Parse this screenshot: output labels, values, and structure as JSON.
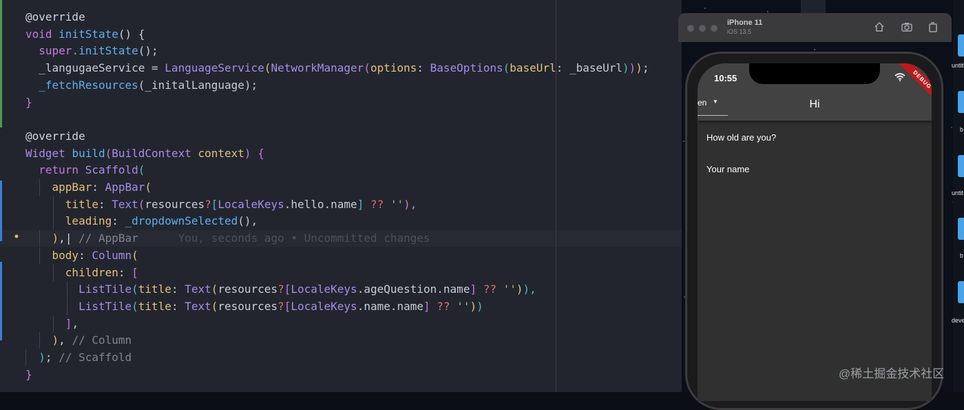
{
  "editor": {
    "lines": [
      {
        "tokens": [
          {
            "t": "@override",
            "c": "ann"
          }
        ]
      },
      {
        "tokens": [
          {
            "t": "void ",
            "c": "kw"
          },
          {
            "t": "initState",
            "c": "fn"
          },
          {
            "t": "() {",
            "c": "default"
          }
        ]
      },
      {
        "tokens": [
          {
            "t": "  "
          },
          {
            "t": "super",
            "c": "kw"
          },
          {
            "t": ".initState",
            "c": "fn"
          },
          {
            "t": "();",
            "c": "default"
          }
        ]
      },
      {
        "tokens": [
          {
            "t": "  _langugaeService = ",
            "c": "default"
          },
          {
            "t": "LanguageService",
            "c": "cls"
          },
          {
            "t": "(",
            "c": "p1"
          },
          {
            "t": "NetworkManager",
            "c": "cls"
          },
          {
            "t": "(",
            "c": "p2"
          },
          {
            "t": "options",
            "c": "prop"
          },
          {
            "t": ": ",
            "c": "default"
          },
          {
            "t": "BaseOptions",
            "c": "cls"
          },
          {
            "t": "(",
            "c": "p3"
          },
          {
            "t": "baseUrl",
            "c": "prop"
          },
          {
            "t": ": _baseUrl",
            "c": "default"
          },
          {
            "t": ")",
            "c": "p3"
          },
          {
            "t": ")",
            "c": "p2"
          },
          {
            "t": ")",
            "c": "p1"
          },
          {
            "t": ";",
            "c": "default"
          }
        ]
      },
      {
        "tokens": [
          {
            "t": "  _fetchResources",
            "c": "fn"
          },
          {
            "t": "(_initalLanguage);",
            "c": "default"
          }
        ]
      },
      {
        "tokens": [
          {
            "t": "}",
            "c": "p2"
          }
        ]
      },
      {
        "tokens": []
      },
      {
        "tokens": [
          {
            "t": "@override",
            "c": "ann"
          }
        ]
      },
      {
        "tokens": [
          {
            "t": "Widget ",
            "c": "cls"
          },
          {
            "t": "build",
            "c": "fn"
          },
          {
            "t": "(",
            "c": "p2"
          },
          {
            "t": "BuildContext ",
            "c": "cls"
          },
          {
            "t": "context",
            "c": "prop"
          },
          {
            "t": ") {",
            "c": "p2"
          }
        ]
      },
      {
        "tokens": [
          {
            "t": "  "
          },
          {
            "t": "return ",
            "c": "kw"
          },
          {
            "t": "Scaffold",
            "c": "cls"
          },
          {
            "t": "(",
            "c": "p3"
          }
        ]
      },
      {
        "tokens": [
          {
            "t": "    "
          },
          {
            "t": "appBar",
            "c": "prop"
          },
          {
            "t": ": ",
            "c": "default"
          },
          {
            "t": "AppBar",
            "c": "cls"
          },
          {
            "t": "(",
            "c": "p1"
          }
        ]
      },
      {
        "tokens": [
          {
            "t": "      "
          },
          {
            "t": "title",
            "c": "prop"
          },
          {
            "t": ": ",
            "c": "default"
          },
          {
            "t": "Text",
            "c": "cls"
          },
          {
            "t": "(",
            "c": "p2"
          },
          {
            "t": "resources",
            "c": "default"
          },
          {
            "t": "?",
            "c": "op"
          },
          {
            "t": "[",
            "c": "p3"
          },
          {
            "t": "LocaleKeys",
            "c": "cls"
          },
          {
            "t": ".hello.name",
            "c": "default"
          },
          {
            "t": "]",
            "c": "p3"
          },
          {
            "t": " ?? ",
            "c": "op"
          },
          {
            "t": "''",
            "c": "str"
          },
          {
            "t": "),",
            "c": "p2"
          }
        ]
      },
      {
        "tokens": [
          {
            "t": "      "
          },
          {
            "t": "leading",
            "c": "prop"
          },
          {
            "t": ": ",
            "c": "default"
          },
          {
            "t": "_dropdownSelected",
            "c": "fn"
          },
          {
            "t": "(),",
            "c": "default"
          }
        ]
      },
      {
        "tokens": [
          {
            "t": "    "
          },
          {
            "t": ")",
            "c": "p1"
          },
          {
            "t": ",",
            "c": "default"
          },
          {
            "t": "|",
            "c": "cursor"
          },
          {
            "t": " // AppBar",
            "c": "cmt"
          },
          {
            "t": "      You, seconds ago • Uncommitted changes",
            "c": "blame"
          }
        ]
      },
      {
        "tokens": [
          {
            "t": "    "
          },
          {
            "t": "body",
            "c": "prop"
          },
          {
            "t": ": ",
            "c": "default"
          },
          {
            "t": "Column",
            "c": "cls"
          },
          {
            "t": "(",
            "c": "p1"
          }
        ]
      },
      {
        "tokens": [
          {
            "t": "      "
          },
          {
            "t": "children",
            "c": "prop"
          },
          {
            "t": ": ",
            "c": "default"
          },
          {
            "t": "[",
            "c": "p2"
          }
        ]
      },
      {
        "tokens": [
          {
            "t": "        "
          },
          {
            "t": "ListTile",
            "c": "cls"
          },
          {
            "t": "(",
            "c": "p3"
          },
          {
            "t": "title",
            "c": "prop"
          },
          {
            "t": ": ",
            "c": "default"
          },
          {
            "t": "Text",
            "c": "cls"
          },
          {
            "t": "(",
            "c": "p1"
          },
          {
            "t": "resources",
            "c": "default"
          },
          {
            "t": "?",
            "c": "op"
          },
          {
            "t": "[",
            "c": "p2"
          },
          {
            "t": "LocaleKeys",
            "c": "cls"
          },
          {
            "t": ".ageQuestion.name",
            "c": "default"
          },
          {
            "t": "]",
            "c": "p2"
          },
          {
            "t": " ?? ",
            "c": "op"
          },
          {
            "t": "''",
            "c": "str"
          },
          {
            "t": ")",
            "c": "p1"
          },
          {
            "t": "),",
            "c": "p3"
          }
        ]
      },
      {
        "tokens": [
          {
            "t": "        "
          },
          {
            "t": "ListTile",
            "c": "cls"
          },
          {
            "t": "(",
            "c": "p3"
          },
          {
            "t": "title",
            "c": "prop"
          },
          {
            "t": ": ",
            "c": "default"
          },
          {
            "t": "Text",
            "c": "cls"
          },
          {
            "t": "(",
            "c": "p1"
          },
          {
            "t": "resources",
            "c": "default"
          },
          {
            "t": "?",
            "c": "op"
          },
          {
            "t": "[",
            "c": "p2"
          },
          {
            "t": "LocaleKeys",
            "c": "cls"
          },
          {
            "t": ".name.name",
            "c": "default"
          },
          {
            "t": "]",
            "c": "p2"
          },
          {
            "t": " ?? ",
            "c": "op"
          },
          {
            "t": "''",
            "c": "str"
          },
          {
            "t": ")",
            "c": "p1"
          },
          {
            "t": ")",
            "c": "p3"
          }
        ]
      },
      {
        "tokens": [
          {
            "t": "      "
          },
          {
            "t": "]",
            "c": "p2"
          },
          {
            "t": ",",
            "c": "default"
          }
        ]
      },
      {
        "tokens": [
          {
            "t": "    "
          },
          {
            "t": ")",
            "c": "p1"
          },
          {
            "t": ",",
            "c": "default"
          },
          {
            "t": " // Column",
            "c": "cmt"
          }
        ]
      },
      {
        "tokens": [
          {
            "t": "  "
          },
          {
            "t": ")",
            "c": "p3"
          },
          {
            "t": ";",
            "c": "default"
          },
          {
            "t": " // Scaffold",
            "c": "cmt"
          }
        ]
      },
      {
        "tokens": [
          {
            "t": "}",
            "c": "p2"
          }
        ]
      }
    ]
  },
  "simulator": {
    "device_name": "iPhone 11",
    "ios_version": "iOS 13.5"
  },
  "app": {
    "status_time": "10:55",
    "debug_banner": "DEBUG",
    "appbar_title": "Hi",
    "dropdown_value": "en",
    "tiles": [
      "How old are you?",
      "Your name"
    ]
  },
  "desktop": {
    "labels": [
      "untitl",
      "b",
      "untit",
      "b",
      "devel"
    ]
  },
  "watermark": "@稀土掘金技术社区"
}
